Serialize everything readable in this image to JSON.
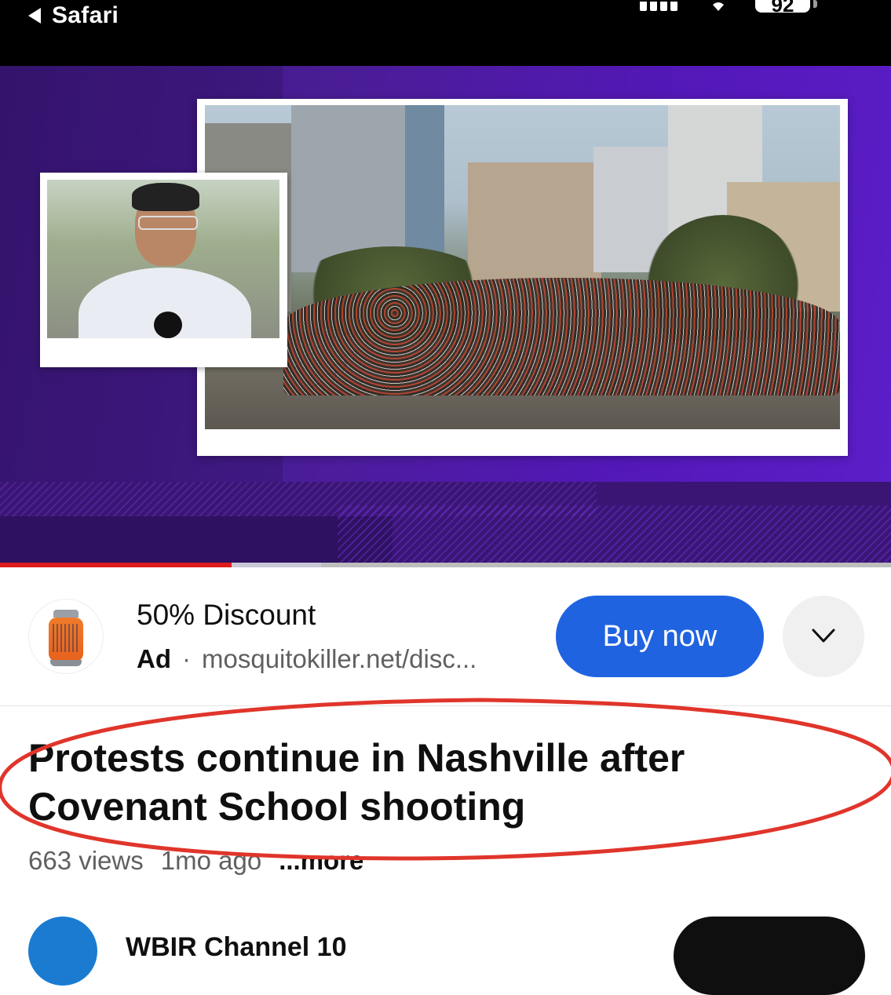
{
  "status_bar": {
    "back_app": "Safari",
    "battery": "92"
  },
  "video": {
    "progress_fraction": 0.26,
    "buffered_fraction": 0.36
  },
  "ad": {
    "title": "50% Discount",
    "label": "Ad",
    "separator": "·",
    "url": "mosquitokiller.net/disc...",
    "cta": "Buy now",
    "icon": "chevron-down-icon"
  },
  "video_info": {
    "title": "Protests continue in Nashville after Covenant School shooting",
    "views": "663 views",
    "age": "1mo ago",
    "more": "...more"
  },
  "channel": {
    "name": "WBIR Channel 10"
  },
  "colors": {
    "accent_red": "#e01b1b",
    "cta_blue": "#1f63e0",
    "annotation_red": "#e0352b",
    "player_purple": "#4a1d96"
  }
}
